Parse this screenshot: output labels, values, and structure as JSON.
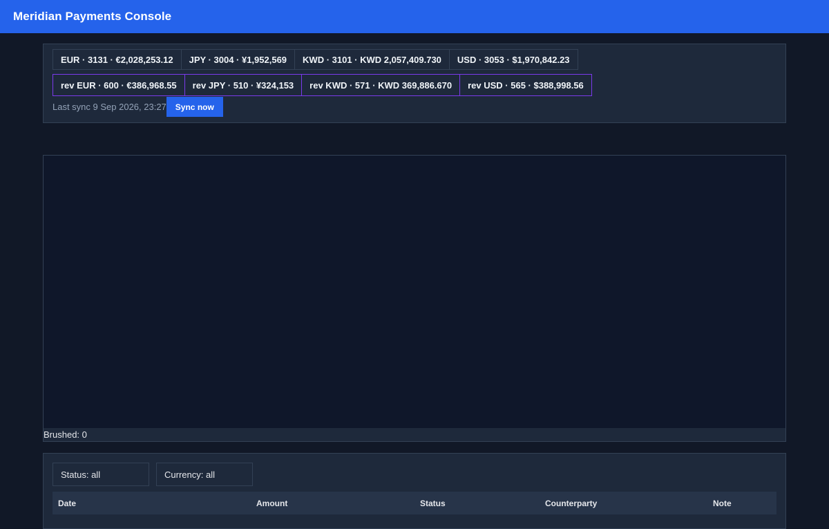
{
  "header": {
    "title": "Meridian Payments Console"
  },
  "summary": {
    "totals": [
      {
        "label": "EUR · 3131 · €2,028,253.12"
      },
      {
        "label": "JPY · 3004 · ¥1,952,569"
      },
      {
        "label": "KWD · 3101 · KWD 2,057,409.730"
      },
      {
        "label": "USD · 3053 · $1,970,842.23"
      }
    ],
    "reversals": [
      {
        "label": "rev EUR · 600 · €386,968.55"
      },
      {
        "label": "rev JPY · 510 · ¥324,153"
      },
      {
        "label": "rev KWD · 571 · KWD 369,886.670"
      },
      {
        "label": "rev USD · 565 · $388,998.56"
      }
    ],
    "last_sync": "Last sync 9 Sep 2026, 23:27",
    "sync_button": "Sync now"
  },
  "chart": {
    "brushed": "Brushed: 0"
  },
  "table": {
    "filters": {
      "status": "Status: all",
      "currency": "Currency: all"
    },
    "columns": [
      "Date",
      "Amount",
      "Status",
      "Counterparty",
      "Note"
    ]
  },
  "colors": {
    "accent": "#2563eb",
    "reversal_border": "#7c3aed",
    "background": "#111827",
    "panel": "#1e293b"
  }
}
